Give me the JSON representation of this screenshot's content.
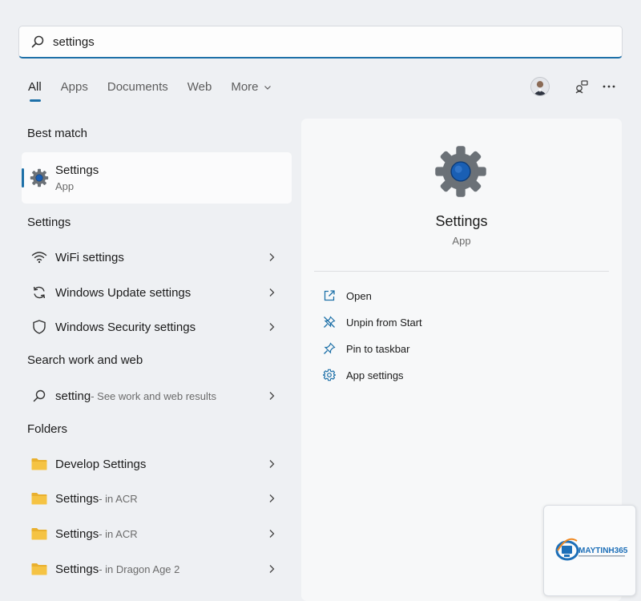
{
  "search": {
    "value": "settings"
  },
  "tabs": [
    {
      "label": "All"
    },
    {
      "label": "Apps"
    },
    {
      "label": "Documents"
    },
    {
      "label": "Web"
    },
    {
      "label": "More"
    }
  ],
  "sections": {
    "best_match": "Best match",
    "settings": "Settings",
    "search_web": "Search work and web",
    "folders": "Folders"
  },
  "best_match_item": {
    "title": "Settings",
    "subtitle": "App",
    "icon": "gear-icon"
  },
  "settings_items": [
    {
      "label": "WiFi settings",
      "icon": "wifi-icon"
    },
    {
      "label": "Windows Update settings",
      "icon": "update-icon"
    },
    {
      "label": "Windows Security settings",
      "icon": "shield-icon"
    }
  ],
  "web_item": {
    "label": "setting",
    "sub": " - See work and web results",
    "icon": "search-icon"
  },
  "folder_items": [
    {
      "label": "Develop Settings",
      "sub": ""
    },
    {
      "label": "Settings",
      "sub": " - in ACR"
    },
    {
      "label": "Settings",
      "sub": " - in ACR"
    },
    {
      "label": "Settings",
      "sub": " - in Dragon Age 2"
    }
  ],
  "preview": {
    "title": "Settings",
    "subtitle": "App",
    "actions": [
      {
        "label": "Open",
        "icon": "open-external-icon"
      },
      {
        "label": "Unpin from Start",
        "icon": "unpin-icon"
      },
      {
        "label": "Pin to taskbar",
        "icon": "pin-icon"
      },
      {
        "label": "App settings",
        "icon": "gear-icon"
      }
    ]
  },
  "watermark": {
    "brand": "MAYTINH365"
  },
  "colors": {
    "accent": "#1d70a8",
    "folder": "#f5c343",
    "gear_body": "#6b7177",
    "gear_center": "#1a5fb4"
  }
}
